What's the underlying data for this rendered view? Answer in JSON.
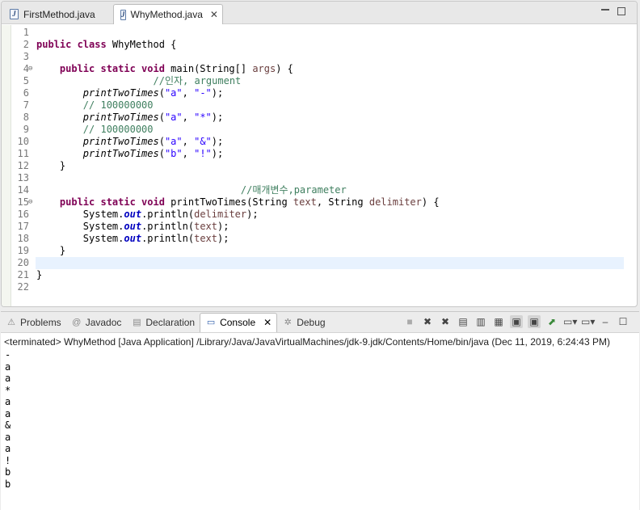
{
  "editor": {
    "tabs": [
      {
        "label": "FirstMethod.java",
        "active": false
      },
      {
        "label": "WhyMethod.java",
        "active": true
      }
    ],
    "lines": [
      {
        "n": "1",
        "html": ""
      },
      {
        "n": "2",
        "html": "<span class='kw'>public class</span> WhyMethod {"
      },
      {
        "n": "3",
        "html": ""
      },
      {
        "n": "4",
        "fold": "⊖",
        "html": "    <span class='kw'>public static void</span> main(String[] <span class='var'>args</span>) {"
      },
      {
        "n": "5",
        "html": "                    <span class='cm'>//인자, argument</span>"
      },
      {
        "n": "6",
        "html": "        <span class='it'>printTwoTimes</span>(<span class='str'>\"a\"</span>, <span class='str'>\"-\"</span>);"
      },
      {
        "n": "7",
        "html": "        <span class='cm'>// 100000000</span>"
      },
      {
        "n": "8",
        "html": "        <span class='it'>printTwoTimes</span>(<span class='str'>\"a\"</span>, <span class='str'>\"*\"</span>);"
      },
      {
        "n": "9",
        "html": "        <span class='cm'>// 100000000</span>"
      },
      {
        "n": "10",
        "html": "        <span class='it'>printTwoTimes</span>(<span class='str'>\"a\"</span>, <span class='str'>\"&amp;\"</span>);"
      },
      {
        "n": "11",
        "html": "        <span class='it'>printTwoTimes</span>(<span class='str'>\"b\"</span>, <span class='str'>\"!\"</span>);"
      },
      {
        "n": "12",
        "html": "    }"
      },
      {
        "n": "13",
        "html": ""
      },
      {
        "n": "14",
        "html": "                                   <span class='cm'>//매개변수,parameter</span>"
      },
      {
        "n": "15",
        "fold": "⊖",
        "html": "    <span class='kw'>public static void</span> printTwoTimes(String <span class='var'>text</span>, String <span class='var'>delimiter</span>) {"
      },
      {
        "n": "16",
        "html": "        System.<span class='field'>out</span>.println(<span class='var'>delimiter</span>);"
      },
      {
        "n": "17",
        "html": "        System.<span class='field'>out</span>.println(<span class='var'>text</span>);"
      },
      {
        "n": "18",
        "html": "        System.<span class='field'>out</span>.println(<span class='var'>text</span>);"
      },
      {
        "n": "19",
        "html": "    }"
      },
      {
        "n": "20",
        "html": "",
        "current": true
      },
      {
        "n": "21",
        "html": "}"
      },
      {
        "n": "22",
        "html": ""
      }
    ]
  },
  "views": {
    "tabs": [
      {
        "label": "Problems",
        "icon": "problems-icon",
        "glyph": "⚠"
      },
      {
        "label": "Javadoc",
        "icon": "javadoc-icon",
        "glyph": "@"
      },
      {
        "label": "Declaration",
        "icon": "declaration-icon",
        "glyph": "▤"
      },
      {
        "label": "Console",
        "icon": "console-icon",
        "glyph": "▭",
        "active": true
      },
      {
        "label": "Debug",
        "icon": "debug-icon",
        "glyph": "✲"
      }
    ],
    "status": "<terminated> WhyMethod [Java Application] /Library/Java/JavaVirtualMachines/jdk-9.jdk/Contents/Home/bin/java (Dec 11, 2019, 6:24:43 PM)",
    "output": [
      "-",
      "a",
      "a",
      "*",
      "a",
      "a",
      "&",
      "a",
      "a",
      "!",
      "b",
      "b"
    ]
  }
}
